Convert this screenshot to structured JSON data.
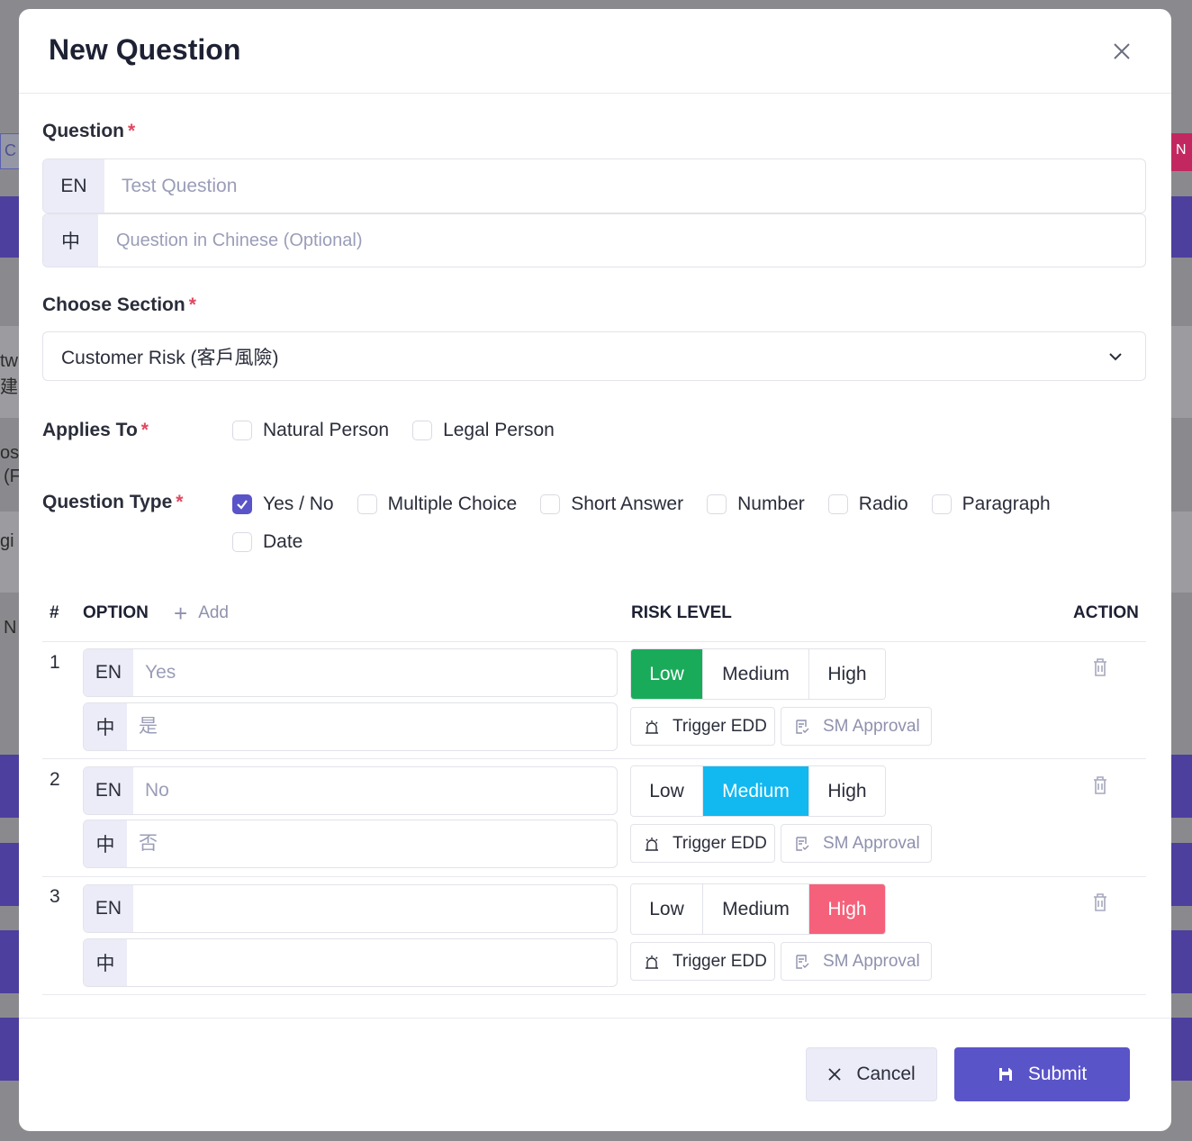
{
  "background": {
    "left_chip": "C",
    "right_chip": "N",
    "left_fragments": [
      "tw",
      "建",
      "os",
      "(F",
      "gi",
      "N"
    ]
  },
  "modal": {
    "title": "New Question",
    "question": {
      "label": "Question",
      "required_mark": "*",
      "en_tag": "EN",
      "en_value": "Test Question",
      "zh_tag": "中",
      "zh_placeholder": "Question in Chinese (Optional)"
    },
    "section": {
      "label": "Choose Section",
      "required_mark": "*",
      "selected": "Customer Risk (客戶風險)"
    },
    "applies_to": {
      "label": "Applies To",
      "required_mark": "*",
      "options": [
        {
          "label": "Natural Person",
          "checked": false
        },
        {
          "label": "Legal Person",
          "checked": false
        }
      ]
    },
    "question_type": {
      "label": "Question Type",
      "required_mark": "*",
      "options": [
        {
          "label": "Yes / No",
          "checked": true
        },
        {
          "label": "Multiple Choice",
          "checked": false
        },
        {
          "label": "Short Answer",
          "checked": false
        },
        {
          "label": "Number",
          "checked": false
        },
        {
          "label": "Radio",
          "checked": false
        },
        {
          "label": "Paragraph",
          "checked": false
        },
        {
          "label": "Date",
          "checked": false
        }
      ]
    },
    "options_table": {
      "headers": {
        "num": "#",
        "option": "OPTION",
        "add": "Add",
        "risk": "RISK LEVEL",
        "action": "ACTION"
      },
      "risk_levels": [
        "Low",
        "Medium",
        "High"
      ],
      "tags": {
        "edd": "Trigger EDD",
        "sm": "SM Approval"
      },
      "colors": {
        "low": "#1aab5a",
        "medium": "#12b8f0",
        "high": "#f5617a"
      },
      "rows": [
        {
          "num": "1",
          "en_tag": "EN",
          "en_value": "Yes",
          "zh_tag": "中",
          "zh_value": "是",
          "risk": "Low"
        },
        {
          "num": "2",
          "en_tag": "EN",
          "en_value": "No",
          "zh_tag": "中",
          "zh_value": "否",
          "risk": "Medium"
        },
        {
          "num": "3",
          "en_tag": "EN",
          "en_value": "",
          "zh_tag": "中",
          "zh_value": "",
          "risk": "High"
        }
      ]
    },
    "footer": {
      "cancel": "Cancel",
      "submit": "Submit"
    }
  }
}
